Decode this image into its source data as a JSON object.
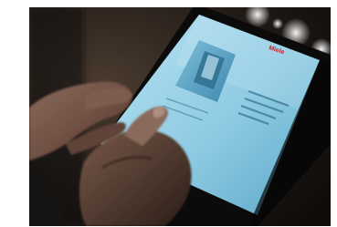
{
  "photo": {
    "alt": "",
    "screen_brand_text": "Miele",
    "palette": {
      "background_dark": "#14110e",
      "background_warm": "#3a2f25",
      "tablet_bezel": "#0b0b0c",
      "screen_glow": "#9fd4ea",
      "screen_panel": "#6fb0cf",
      "skin_shadow": "#3b2a22",
      "skin_mid": "#6b4c3f",
      "skin_light": "#8a6b5c",
      "bokeh": "#f2f2f0",
      "brand_red": "#c8202c"
    }
  }
}
